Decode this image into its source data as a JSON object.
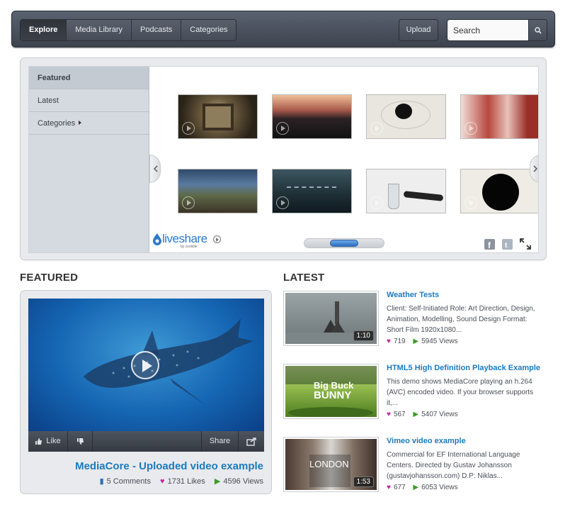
{
  "nav": {
    "tabs": [
      "Explore",
      "Media Library",
      "Podcasts",
      "Categories"
    ],
    "active_tab": "Explore",
    "upload_label": "Upload",
    "search_placeholder": "Search"
  },
  "widget": {
    "menu": [
      "Featured",
      "Latest",
      "Categories"
    ],
    "active_menu": "Featured",
    "brand": "liveshare",
    "brand_sub": "by coolsite"
  },
  "featured": {
    "heading": "FEATURED",
    "like_label": "Like",
    "share_label": "Share",
    "title": "MediaCore - Uploaded video example",
    "comments": "5 Comments",
    "likes": "1731 Likes",
    "views": "4596 Views"
  },
  "latest": {
    "heading": "LATEST",
    "items": [
      {
        "title": "Weather Tests",
        "desc": "Client: Self-Initiated Role: Art Direction, Design, Animation, Modelling, Sound Design Format: Short Film 1920x1080...",
        "likes": "719",
        "views": "5945 Views",
        "duration": "1:10"
      },
      {
        "title": "HTML5 High Definition Playback Example",
        "desc": "This demo shows MediaCore playing an h.264 (AVC) encoded video. If your browser supports it,...",
        "likes": "567",
        "views": "5407 Views",
        "duration": ""
      },
      {
        "title": "Vimeo video example",
        "desc": "Commercial for EF International Language Centers. Directed by Gustav Johansson (gustavjohansson.com) D.P: Niklas...",
        "likes": "677",
        "views": "6053 Views",
        "duration": "1:53"
      }
    ]
  },
  "colors": {
    "link": "#1a7bbf",
    "heart": "#c0289c",
    "play_green": "#3a9c28"
  }
}
